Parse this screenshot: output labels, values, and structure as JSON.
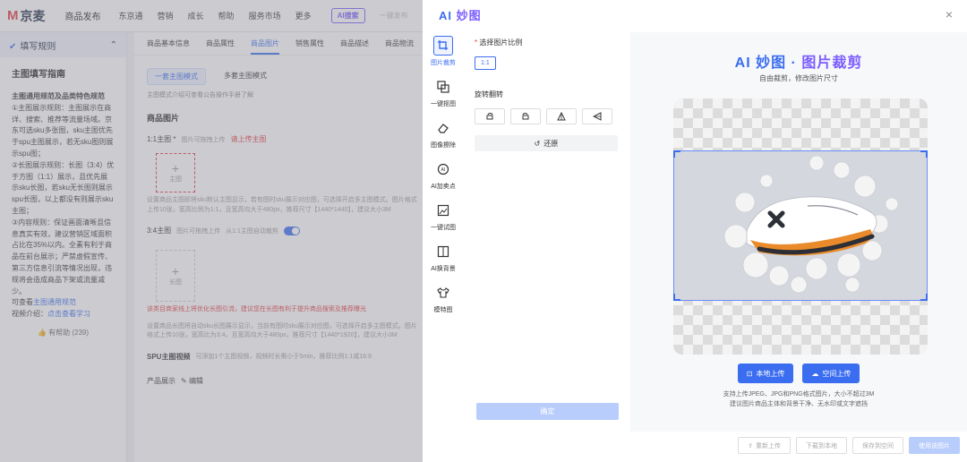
{
  "topbar": {
    "logo": "京麦",
    "nav": [
      "商品发布",
      "东京通",
      "营销",
      "成长",
      "帮助",
      "服务市场",
      "更多"
    ],
    "ai_pill": "AI搜索",
    "search_placeholder": "一键发布"
  },
  "left_panel": {
    "header": "填写规则",
    "title": "主图填写指南",
    "paragraphs": [
      "主图通用规范及品类特色规范",
      "①主图展示规则：主图展示在商详、搜索、推荐等流量场域。京东可选sku多张图，sku主图优先于spu主图展示，若无sku图则展示spu图；",
      "②长图展示规则：长图（3:4）优于方图（1:1）展示，且优先展示sku长图，若sku无长图则展示spu长图，以上都没有则展示sku主图；",
      "③内容规则：保证画面清晰且信息真实有效，建议营销区域面积占比在35%以内。全素有利于商品在前台展示；严禁虚假宣传、第三方信息引流等情况出现，违规将会造成商品下架或流量减少。"
    ],
    "more_prefix": "可查看",
    "more_link": "主图通用规范",
    "video_prefix": "视频介绍：",
    "video_link": "点击查看学习",
    "help": "有帮助 (239)"
  },
  "main": {
    "tabs": [
      "商品基本信息",
      "商品属性",
      "商品图片",
      "销售属性",
      "商品描述",
      "商品物流"
    ],
    "modes": [
      "一套主图模式",
      "多套主图模式"
    ],
    "mode_hint": "主图模式介绍可查看公告操作手册了解",
    "section_title": "商品图片",
    "main_label": "1:1主图 *",
    "main_note": "图片可拖拽上传",
    "main_red": "请上传主图",
    "upload_label": "主图",
    "main_desc": "设置商品主图即将sku默认主图显示，若有图时sku展示对应图，可选择开启多主图模式。图片格式上传10张，宽高比例为1:1，且宽高均大于480px，推荐尺寸【1440*1440】，建议大小3M",
    "long_label": "3:4主图",
    "long_note": "图片可拖拽上传",
    "long_toggle_label": "从1:1主图自动裁剪",
    "long_upload": "长图",
    "long_warn": "该类目商家线上将优化长图引流，建议您在长图有利于提升商品搜索及推荐曝光",
    "long_desc": "设置商品长图将自动sku长图展示显示，当前有图时sku展示对应图，可选择开启多主图模式。图片格式上传10张，宽高比为3:4，且宽高均大于480px，推荐尺寸【1440*1920】，建议大小3M",
    "spu_label": "SPU主图视频",
    "spu_note": "可添加1个主图视频，视频时长需小于5min，推荐比例1:1或16:9",
    "product_show": "产品展示",
    "edit": "编辑"
  },
  "drawer": {
    "title_a": "AI ",
    "title_b": "妙图",
    "close": "×",
    "tools": [
      {
        "label": "图片裁剪",
        "icon": "crop-icon"
      },
      {
        "label": "一键抠图",
        "icon": "cutout-icon"
      },
      {
        "label": "图像擦除",
        "icon": "eraser-icon"
      },
      {
        "label": "AI加卖点",
        "icon": "selling-point-icon"
      },
      {
        "label": "一键试图",
        "icon": "try-image-icon"
      },
      {
        "label": "AI换背景",
        "icon": "background-icon"
      },
      {
        "label": "模特图",
        "icon": "model-shirt-icon"
      }
    ],
    "ratio_label": "选择图片比例",
    "ratio_value": "1:1",
    "rotate_label": "旋转翻转",
    "reset": "还原",
    "confirm": "确定",
    "preview_title_a": "AI 妙图 · ",
    "preview_title_b": "图片裁剪",
    "preview_sub": "自由裁剪，修改图片尺寸",
    "local_upload": "本地上传",
    "cloud_upload": "空间上传",
    "note_line1": "支持上传JPEG、JPG和PNG格式图片，大小不超过3M",
    "note_line2": "建议图片商品主体和背景干净、无水印或文字遮挡",
    "footer": [
      "重新上传",
      "下载到本地",
      "保存到空间",
      "使用该图片"
    ]
  }
}
